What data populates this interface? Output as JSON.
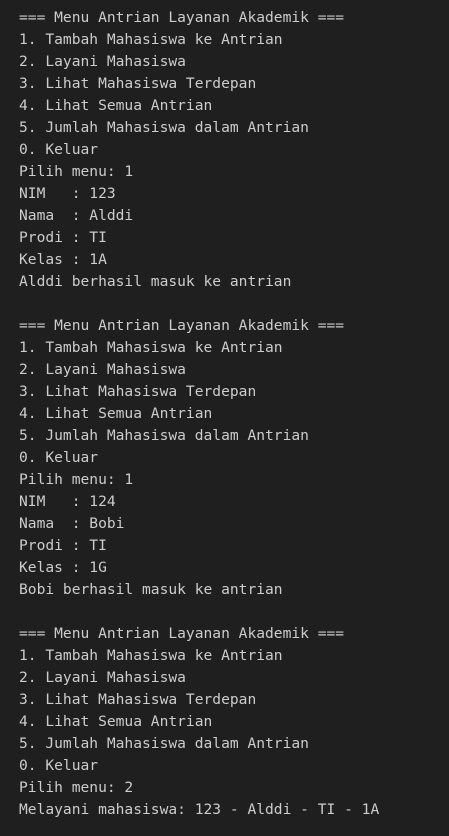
{
  "terminal": {
    "lines": [
      "=== Menu Antrian Layanan Akademik ===",
      "1. Tambah Mahasiswa ke Antrian",
      "2. Layani Mahasiswa",
      "3. Lihat Mahasiswa Terdepan",
      "4. Lihat Semua Antrian",
      "5. Jumlah Mahasiswa dalam Antrian",
      "0. Keluar",
      "Pilih menu: 1",
      "NIM   : 123",
      "Nama  : Alddi",
      "Prodi : TI",
      "Kelas : 1A",
      "Alddi berhasil masuk ke antrian",
      "",
      "=== Menu Antrian Layanan Akademik ===",
      "1. Tambah Mahasiswa ke Antrian",
      "2. Layani Mahasiswa",
      "3. Lihat Mahasiswa Terdepan",
      "4. Lihat Semua Antrian",
      "5. Jumlah Mahasiswa dalam Antrian",
      "0. Keluar",
      "Pilih menu: 1",
      "NIM   : 124",
      "Nama  : Bobi",
      "Prodi : TI",
      "Kelas : 1G",
      "Bobi berhasil masuk ke antrian",
      "",
      "=== Menu Antrian Layanan Akademik ===",
      "1. Tambah Mahasiswa ke Antrian",
      "2. Layani Mahasiswa",
      "3. Lihat Mahasiswa Terdepan",
      "4. Lihat Semua Antrian",
      "5. Jumlah Mahasiswa dalam Antrian",
      "0. Keluar",
      "Pilih menu: 2",
      "Melayani mahasiswa: 123 - Alddi - TI - 1A"
    ]
  }
}
